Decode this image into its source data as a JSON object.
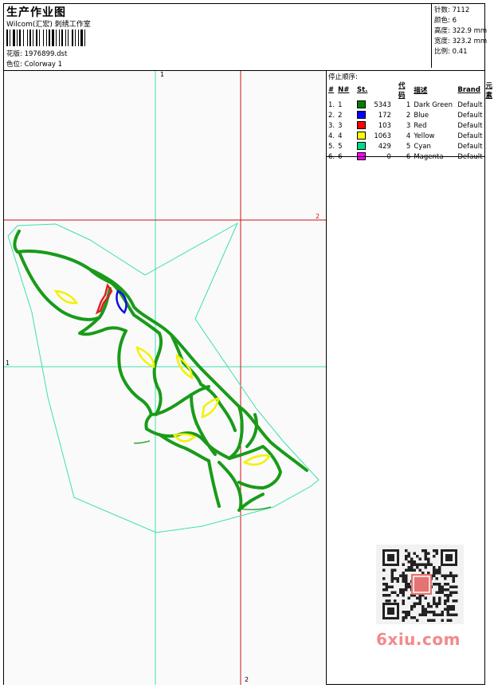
{
  "header": {
    "title": "生产作业图",
    "company": "Wilcom(汇宏) 刺绣工作室",
    "design_label": "花版: 1976899.dst",
    "colorway_label": "色位: Colorway 1"
  },
  "stats": [
    {
      "label": "针数",
      "value": "7112"
    },
    {
      "label": "颜色",
      "value": "6"
    },
    {
      "label": "高度",
      "value": "322.9 mm"
    },
    {
      "label": "宽度",
      "value": "323.2 mm"
    },
    {
      "label": "比例",
      "value": "0.41"
    }
  ],
  "stop_sequence": {
    "title": "停止顺序:",
    "columns": [
      "#",
      "N#",
      "St.",
      "代码",
      "描述",
      "Brand",
      "元素"
    ],
    "rows": [
      {
        "idx": "1.",
        "n": "1",
        "color": "#008000",
        "st": "5343",
        "code": "1",
        "desc": "Dark Green",
        "brand": "Default"
      },
      {
        "idx": "2.",
        "n": "2",
        "color": "#0000ff",
        "st": "172",
        "code": "2",
        "desc": "Blue",
        "brand": "Default"
      },
      {
        "idx": "3.",
        "n": "3",
        "color": "#ff0000",
        "st": "103",
        "code": "3",
        "desc": "Red",
        "brand": "Default"
      },
      {
        "idx": "4.",
        "n": "4",
        "color": "#ffff00",
        "st": "1063",
        "code": "4",
        "desc": "Yellow",
        "brand": "Default"
      },
      {
        "idx": "5.",
        "n": "5",
        "color": "#00d890",
        "st": "429",
        "code": "5",
        "desc": "Cyan",
        "brand": "Default"
      },
      {
        "idx": "6.",
        "n": "6",
        "color": "#ff00ff",
        "st": "0",
        "code": "6",
        "desc": "Magenta",
        "brand": "Default"
      }
    ]
  },
  "guides": {
    "cyan_label": "1",
    "red_label": "2"
  },
  "colors": {
    "green": "#199b19",
    "cyan": "#3ee0a8",
    "red": "#e02020",
    "yellow": "#f2f200",
    "blue": "#1010e0",
    "guide_cyan": "#40e0b0",
    "guide_red": "#d01010"
  },
  "watermark": "6xiu.com"
}
